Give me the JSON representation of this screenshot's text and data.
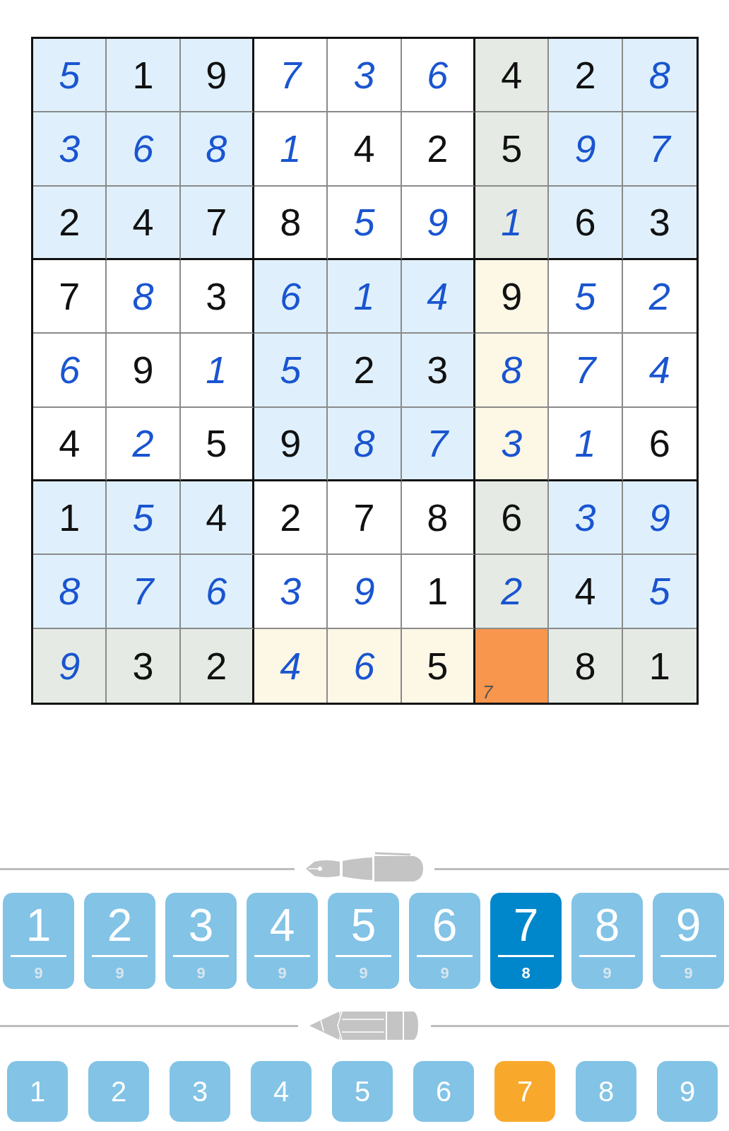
{
  "board": {
    "rows": [
      {
        "cells": [
          {
            "value": "5",
            "kind": "entered",
            "selected": false
          },
          {
            "value": "1",
            "kind": "given",
            "selected": false
          },
          {
            "value": "9",
            "kind": "given",
            "selected": false
          },
          {
            "value": "7",
            "kind": "entered",
            "selected": false
          },
          {
            "value": "3",
            "kind": "entered",
            "selected": false
          },
          {
            "value": "6",
            "kind": "entered",
            "selected": false
          },
          {
            "value": "4",
            "kind": "given",
            "selected": false
          },
          {
            "value": "2",
            "kind": "given",
            "selected": false
          },
          {
            "value": "8",
            "kind": "entered",
            "selected": false
          }
        ]
      },
      {
        "cells": [
          {
            "value": "3",
            "kind": "entered",
            "selected": false
          },
          {
            "value": "6",
            "kind": "entered",
            "selected": false
          },
          {
            "value": "8",
            "kind": "entered",
            "selected": false
          },
          {
            "value": "1",
            "kind": "entered",
            "selected": false
          },
          {
            "value": "4",
            "kind": "given",
            "selected": false
          },
          {
            "value": "2",
            "kind": "given",
            "selected": false
          },
          {
            "value": "5",
            "kind": "given",
            "selected": false
          },
          {
            "value": "9",
            "kind": "entered",
            "selected": false
          },
          {
            "value": "7",
            "kind": "entered",
            "selected": false
          }
        ]
      },
      {
        "cells": [
          {
            "value": "2",
            "kind": "given",
            "selected": false
          },
          {
            "value": "4",
            "kind": "given",
            "selected": false
          },
          {
            "value": "7",
            "kind": "given",
            "selected": false
          },
          {
            "value": "8",
            "kind": "given",
            "selected": false
          },
          {
            "value": "5",
            "kind": "entered",
            "selected": false
          },
          {
            "value": "9",
            "kind": "entered",
            "selected": false
          },
          {
            "value": "1",
            "kind": "entered",
            "selected": false
          },
          {
            "value": "6",
            "kind": "given",
            "selected": false
          },
          {
            "value": "3",
            "kind": "given",
            "selected": false
          }
        ]
      },
      {
        "cells": [
          {
            "value": "7",
            "kind": "given",
            "selected": false
          },
          {
            "value": "8",
            "kind": "entered",
            "selected": false
          },
          {
            "value": "3",
            "kind": "given",
            "selected": false
          },
          {
            "value": "6",
            "kind": "entered",
            "selected": false
          },
          {
            "value": "1",
            "kind": "entered",
            "selected": false
          },
          {
            "value": "4",
            "kind": "entered",
            "selected": false
          },
          {
            "value": "9",
            "kind": "given",
            "selected": false
          },
          {
            "value": "5",
            "kind": "entered",
            "selected": false
          },
          {
            "value": "2",
            "kind": "entered",
            "selected": false
          }
        ]
      },
      {
        "cells": [
          {
            "value": "6",
            "kind": "entered",
            "selected": false
          },
          {
            "value": "9",
            "kind": "given",
            "selected": false
          },
          {
            "value": "1",
            "kind": "entered",
            "selected": false
          },
          {
            "value": "5",
            "kind": "entered",
            "selected": false
          },
          {
            "value": "2",
            "kind": "given",
            "selected": false
          },
          {
            "value": "3",
            "kind": "given",
            "selected": false
          },
          {
            "value": "8",
            "kind": "entered",
            "selected": false
          },
          {
            "value": "7",
            "kind": "entered",
            "selected": false
          },
          {
            "value": "4",
            "kind": "entered",
            "selected": false
          }
        ]
      },
      {
        "cells": [
          {
            "value": "4",
            "kind": "given",
            "selected": false
          },
          {
            "value": "2",
            "kind": "entered",
            "selected": false
          },
          {
            "value": "5",
            "kind": "given",
            "selected": false
          },
          {
            "value": "9",
            "kind": "given",
            "selected": false
          },
          {
            "value": "8",
            "kind": "entered",
            "selected": false
          },
          {
            "value": "7",
            "kind": "entered",
            "selected": false
          },
          {
            "value": "3",
            "kind": "entered",
            "selected": false
          },
          {
            "value": "1",
            "kind": "entered",
            "selected": false
          },
          {
            "value": "6",
            "kind": "given",
            "selected": false
          }
        ]
      },
      {
        "cells": [
          {
            "value": "1",
            "kind": "given",
            "selected": false
          },
          {
            "value": "5",
            "kind": "entered",
            "selected": false
          },
          {
            "value": "4",
            "kind": "given",
            "selected": false
          },
          {
            "value": "2",
            "kind": "given",
            "selected": false
          },
          {
            "value": "7",
            "kind": "given",
            "selected": false
          },
          {
            "value": "8",
            "kind": "given",
            "selected": false
          },
          {
            "value": "6",
            "kind": "given",
            "selected": false
          },
          {
            "value": "3",
            "kind": "entered",
            "selected": false
          },
          {
            "value": "9",
            "kind": "entered",
            "selected": false
          }
        ]
      },
      {
        "cells": [
          {
            "value": "8",
            "kind": "entered",
            "selected": false
          },
          {
            "value": "7",
            "kind": "entered",
            "selected": false
          },
          {
            "value": "6",
            "kind": "entered",
            "selected": false
          },
          {
            "value": "3",
            "kind": "entered",
            "selected": false
          },
          {
            "value": "9",
            "kind": "entered",
            "selected": false
          },
          {
            "value": "1",
            "kind": "given",
            "selected": false
          },
          {
            "value": "2",
            "kind": "entered",
            "selected": false
          },
          {
            "value": "4",
            "kind": "given",
            "selected": false
          },
          {
            "value": "5",
            "kind": "entered",
            "selected": false
          }
        ]
      },
      {
        "cells": [
          {
            "value": "9",
            "kind": "entered",
            "selected": false
          },
          {
            "value": "3",
            "kind": "given",
            "selected": false
          },
          {
            "value": "2",
            "kind": "given",
            "selected": false
          },
          {
            "value": "4",
            "kind": "entered",
            "selected": false
          },
          {
            "value": "6",
            "kind": "entered",
            "selected": false
          },
          {
            "value": "5",
            "kind": "given",
            "selected": false
          },
          {
            "kind": "empty",
            "selected": true,
            "notes": [
              "7"
            ]
          },
          {
            "value": "8",
            "kind": "given",
            "selected": false
          },
          {
            "value": "1",
            "kind": "given",
            "selected": false
          }
        ]
      }
    ]
  },
  "pen_keypad": [
    {
      "digit": "1",
      "count": "9",
      "selected": false
    },
    {
      "digit": "2",
      "count": "9",
      "selected": false
    },
    {
      "digit": "3",
      "count": "9",
      "selected": false
    },
    {
      "digit": "4",
      "count": "9",
      "selected": false
    },
    {
      "digit": "5",
      "count": "9",
      "selected": false
    },
    {
      "digit": "6",
      "count": "9",
      "selected": false
    },
    {
      "digit": "7",
      "count": "8",
      "selected": true
    },
    {
      "digit": "8",
      "count": "9",
      "selected": false
    },
    {
      "digit": "9",
      "count": "9",
      "selected": false
    }
  ],
  "pencil_keypad": [
    {
      "digit": "1",
      "selected": false
    },
    {
      "digit": "2",
      "selected": false
    },
    {
      "digit": "3",
      "selected": false
    },
    {
      "digit": "4",
      "selected": false
    },
    {
      "digit": "5",
      "selected": false
    },
    {
      "digit": "6",
      "selected": false
    },
    {
      "digit": "7",
      "selected": true
    },
    {
      "digit": "8",
      "selected": false
    },
    {
      "digit": "9",
      "selected": false
    }
  ]
}
